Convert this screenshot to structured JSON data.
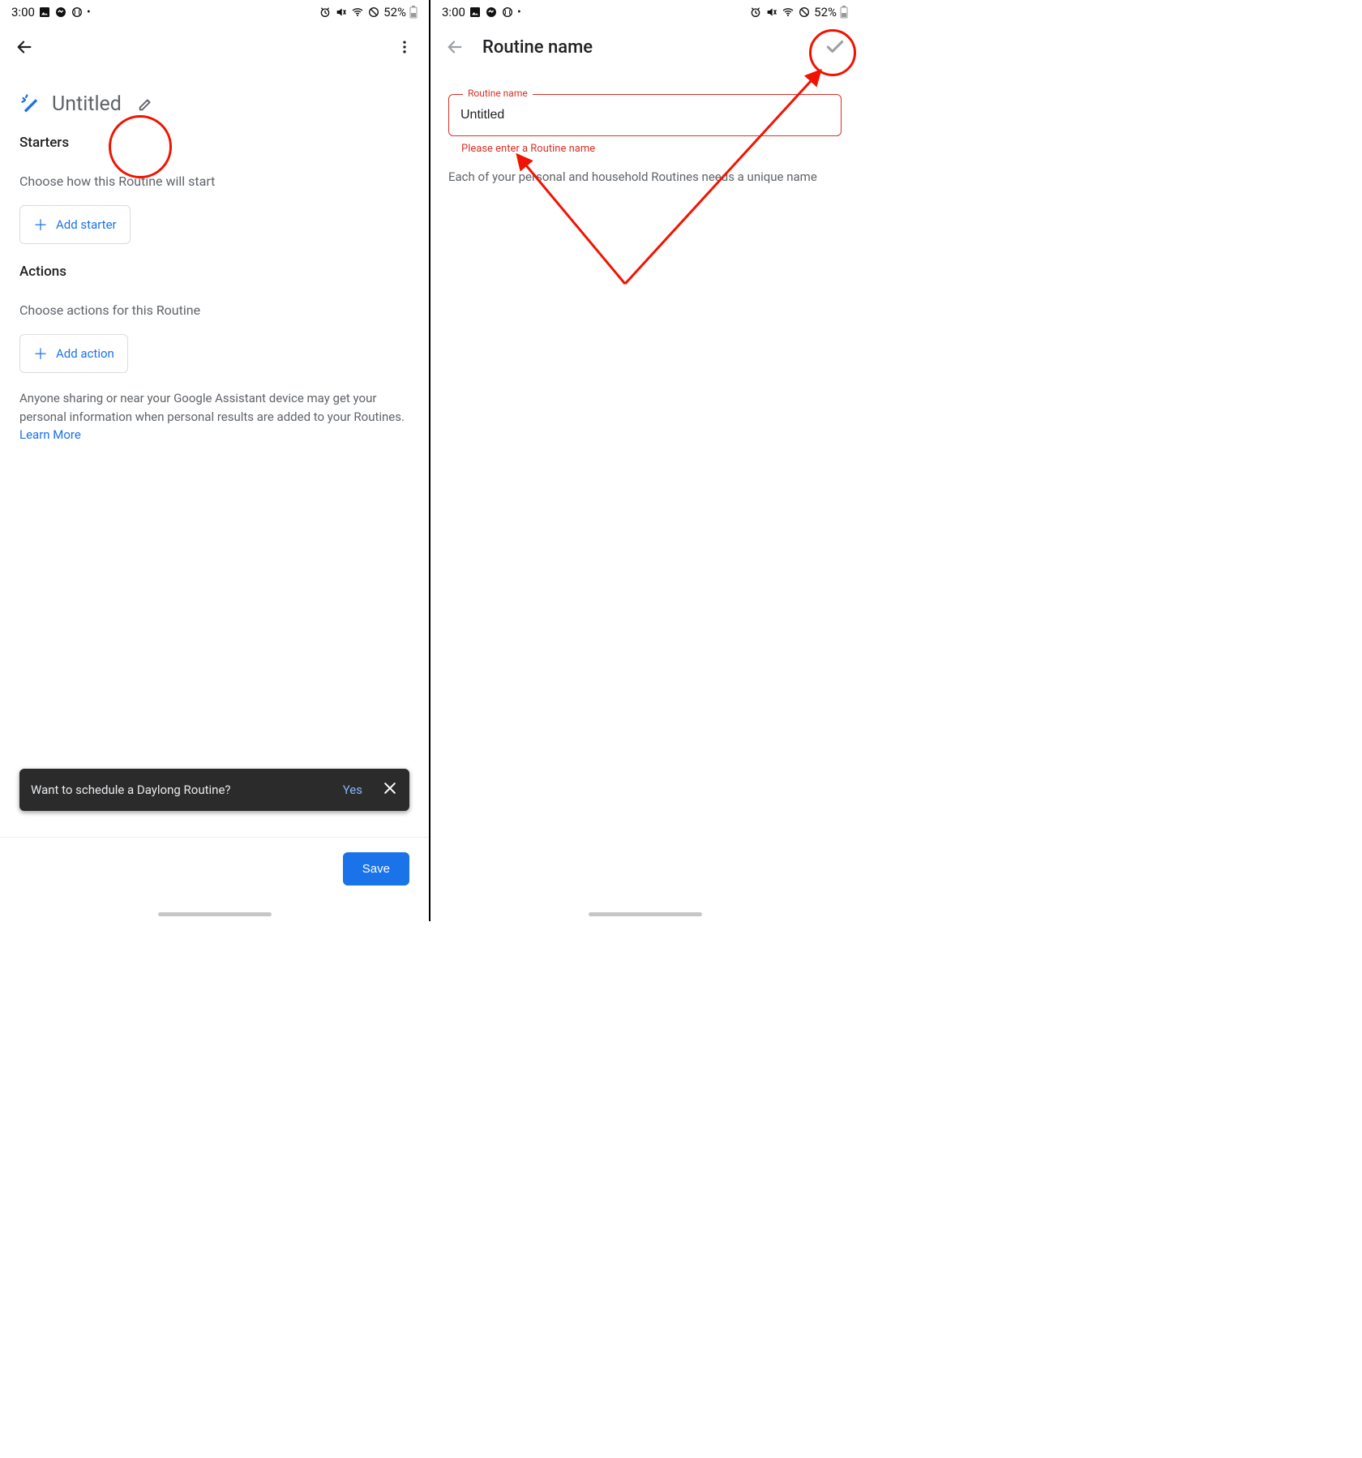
{
  "statusbar": {
    "time": "3:00",
    "battery_text": "52%"
  },
  "left": {
    "title": "Untitled",
    "starters_heading": "Starters",
    "starters_sub": "Choose how this Routine will start",
    "add_starter_label": "Add starter",
    "actions_heading": "Actions",
    "actions_sub": "Choose actions for this Routine",
    "add_action_label": "Add action",
    "info_text": "Anyone sharing or near your Google Assistant device may get your personal information when personal results are added to your Routines. ",
    "learn_more": "Learn More",
    "snackbar_text": "Want to schedule a Daylong Routine?",
    "snackbar_yes": "Yes",
    "save_label": "Save"
  },
  "right": {
    "header_title": "Routine name",
    "field_label": "Routine name",
    "field_value": "Untitled",
    "field_error": "Please enter a Routine name",
    "helper_text": "Each of your personal and household Routines needs a unique name"
  }
}
